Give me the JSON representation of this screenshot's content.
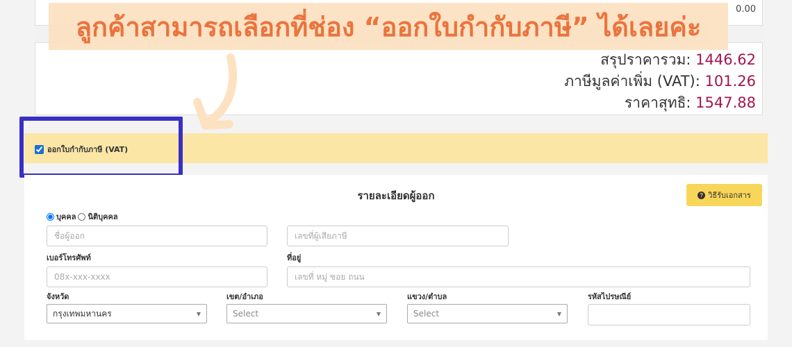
{
  "summary": {
    "row_value": "0.00",
    "subtotal_label": "สรุปราคารวม:",
    "subtotal": "1446.62",
    "vat_label": "ภาษีมูลค่าเพิ่ม (VAT):",
    "vat": "101.26",
    "net_label": "ราคาสุทธิ:",
    "net": "1547.88"
  },
  "annotation": {
    "text": "ลูกค้าสามารถเลือกที่ช่อง “ออกใบกำกับภาษี” ได้เลยค่ะ"
  },
  "vat_option": {
    "label": "ออกใบกำกับภาษี (VAT)",
    "checked": true
  },
  "form": {
    "title": "รายละเอียดผู้ออก",
    "doc_button": "วิธีรับเอกสาร",
    "radio_person": "บุคคล",
    "radio_company": "นิติบุคคล",
    "selected": "บุคคล",
    "name_placeholder": "ชื่อผู้ออก",
    "taxid_placeholder": "เลขที่ผู้เสียภาษี",
    "phone_label": "เบอร์โทรศัพท์",
    "phone_placeholder": "08x-xxx-xxxx",
    "address_label": "ที่อยู่",
    "address_placeholder": "เลขที่ หมู่ ซอย ถนน",
    "province_label": "จังหวัด",
    "province_value": "กรุงเทพมหานคร",
    "district_label": "เขต/อำเภอ",
    "district_value": "Select",
    "subdistrict_label": "แขวง/ตำบล",
    "subdistrict_value": "Select",
    "zip_label": "รหัสไปรษณีย์",
    "zip_value": ""
  },
  "colors": {
    "accent": "#a3154f",
    "highlight": "#3a2fc4",
    "band": "#fbe6a6",
    "button": "#f8d65a",
    "annotation": "#ea6d34"
  }
}
